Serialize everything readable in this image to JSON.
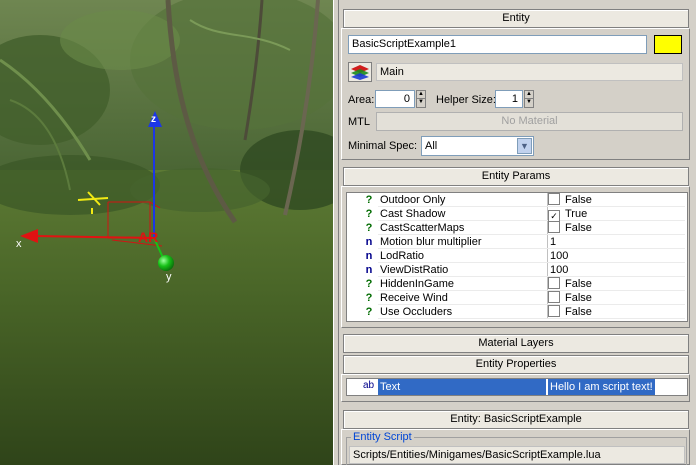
{
  "viewport": {
    "axis_x": "x",
    "axis_y": "y",
    "axis_z": "z",
    "label_ar": "AR",
    "colors": {
      "x_axis": "#e11212",
      "y_axis": "#18c218",
      "z_axis": "#1c36e6",
      "helper": "#f2ea14"
    }
  },
  "entity": {
    "header": "Entity",
    "name": "BasicScriptExample1",
    "color_swatch": "#ffff00",
    "layer_icon": "layers-icon",
    "layer": "Main",
    "area_label": "Area:",
    "area_value": "0",
    "helper_size_label": "Helper Size:",
    "helper_size_value": "1",
    "mtl_label": "MTL",
    "mtl_value": "No Material",
    "min_spec_label": "Minimal Spec:",
    "min_spec_value": "All"
  },
  "entity_params": {
    "header": "Entity Params",
    "rows": [
      {
        "icon": "?",
        "name": "Outdoor Only",
        "checkbox": true,
        "checked": "",
        "value": "False"
      },
      {
        "icon": "?",
        "name": "Cast Shadow",
        "checkbox": true,
        "checked": "✓",
        "value": "True"
      },
      {
        "icon": "?",
        "name": "CastScatterMaps",
        "checkbox": true,
        "checked": "",
        "value": "False"
      },
      {
        "icon": "n",
        "name": "Motion blur multiplier",
        "checkbox": false,
        "checked": "",
        "value": "1"
      },
      {
        "icon": "n",
        "name": "LodRatio",
        "checkbox": false,
        "checked": "",
        "value": "100"
      },
      {
        "icon": "n",
        "name": "ViewDistRatio",
        "checkbox": false,
        "checked": "",
        "value": "100"
      },
      {
        "icon": "?",
        "name": "HiddenInGame",
        "checkbox": true,
        "checked": "",
        "value": "False"
      },
      {
        "icon": "?",
        "name": "Receive Wind",
        "checkbox": true,
        "checked": "",
        "value": "False"
      },
      {
        "icon": "?",
        "name": "Use Occluders",
        "checkbox": true,
        "checked": "",
        "value": "False"
      }
    ]
  },
  "material_layers": {
    "header": "Material Layers"
  },
  "entity_properties": {
    "header": "Entity Properties",
    "row": {
      "icon": "ab",
      "name": "Text",
      "value": "Hello I am script text!"
    }
  },
  "entity_script": {
    "header": "Entity: BasicScriptExample",
    "group_label": "Entity Script",
    "path": "Scripts/Entities/Minigames/BasicScriptExample.lua"
  }
}
